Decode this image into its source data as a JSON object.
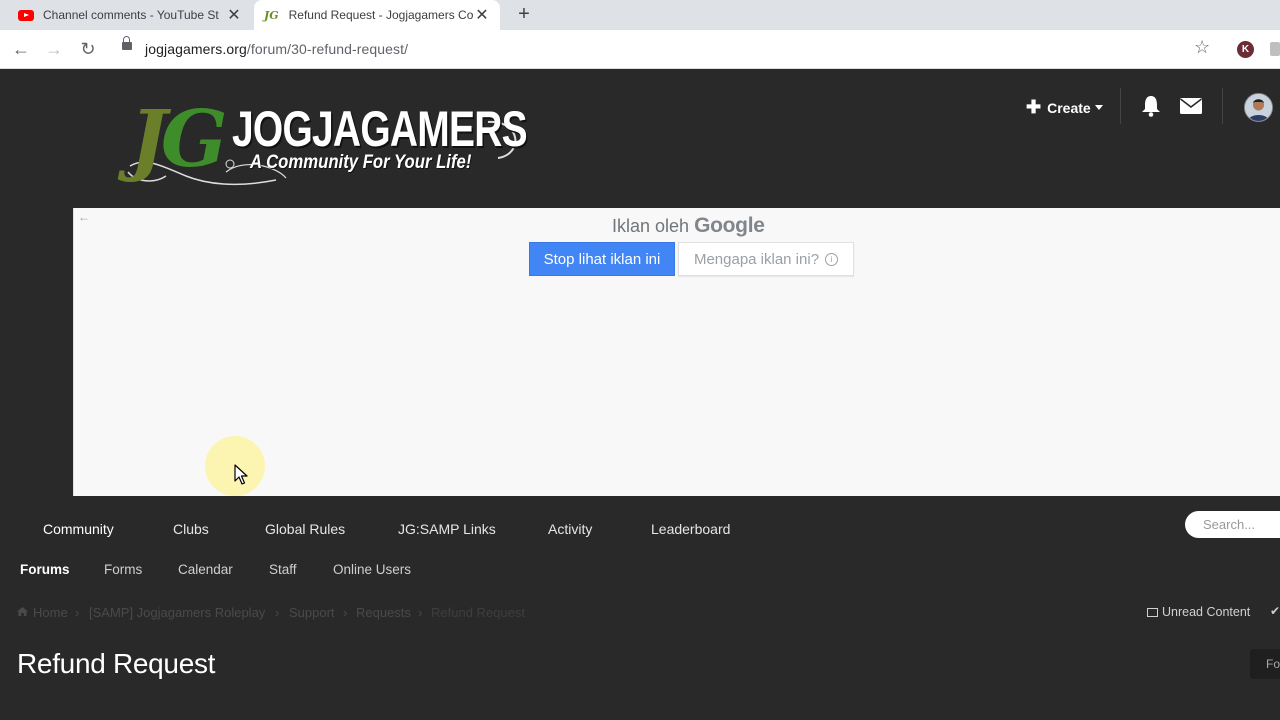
{
  "browser": {
    "tabs": [
      {
        "title": "Channel comments - YouTube St",
        "active": false,
        "favicon": "youtube-icon"
      },
      {
        "title": "Refund Request - Jogjagamers Co",
        "active": true,
        "favicon": "jg-icon"
      }
    ],
    "url_host": "jogjagamers.org",
    "url_path": "/forum/30-refund-request/",
    "profile_initial": "K"
  },
  "header": {
    "logo_letters": "JG",
    "logo_name": "JOGJAGAMERS",
    "logo_tagline": "A Community For Your Life!",
    "create_label": "Create"
  },
  "ad": {
    "label_prefix": "Iklan oleh",
    "label_brand": "Google",
    "stop_label": "Stop lihat iklan ini",
    "why_label": "Mengapa iklan ini?",
    "back_arrow": "←"
  },
  "nav": {
    "primary": [
      "Community",
      "Clubs",
      "Global Rules",
      "JG:SAMP Links",
      "Activity",
      "Leaderboard"
    ],
    "secondary": [
      "Forums",
      "Forms",
      "Calendar",
      "Staff",
      "Online Users"
    ],
    "search_placeholder": "Search..."
  },
  "breadcrumb": [
    "Home",
    "[SAMP] Jogjagamers Roleplay",
    "Support",
    "Requests",
    "Refund Request"
  ],
  "unread_label": "Unread Content",
  "page_title": "Refund Request",
  "follow_label": "Fo",
  "colors": {
    "page_bg": "#292929",
    "ad_button": "#4285f4",
    "logo_green": "#3f8c2a"
  }
}
